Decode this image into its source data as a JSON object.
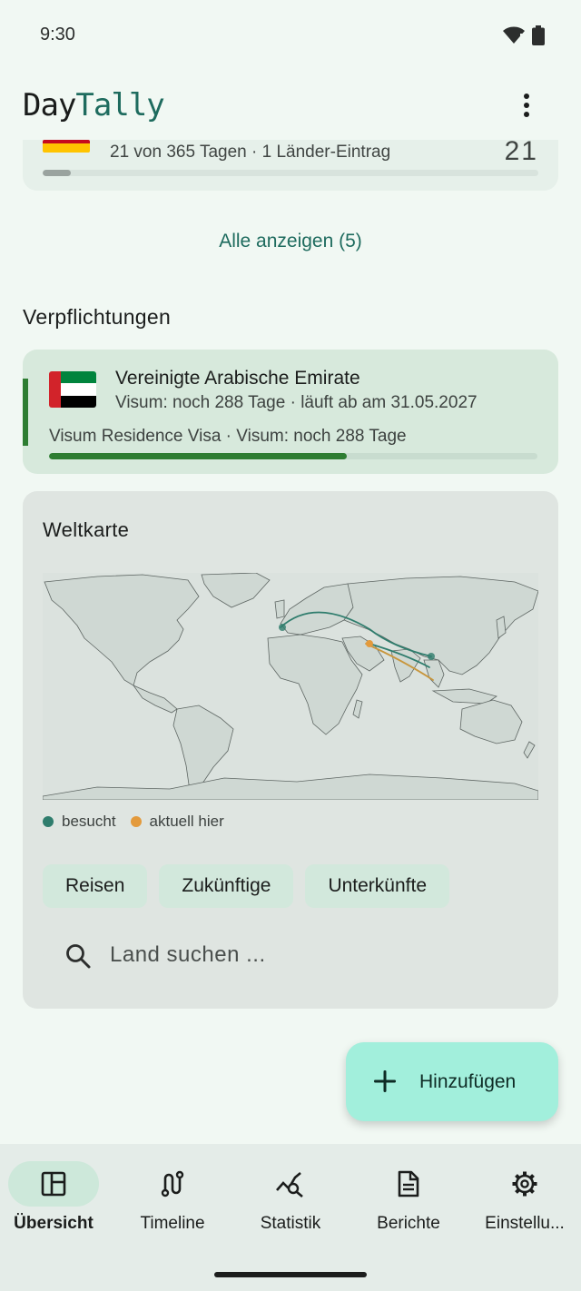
{
  "status": {
    "time": "9:30"
  },
  "app": {
    "title_part1": "Day",
    "title_part2": "Tally"
  },
  "previous_entry": {
    "summary": "21 von 365 Tagen  ·  1 Länder-Eintrag",
    "count": "21",
    "progress": 0.0575
  },
  "show_all": "Alle anzeigen (5)",
  "obligations": {
    "section_title": "Verpflichtungen",
    "items": [
      {
        "country": "Vereinigte Arabische Emirate",
        "detail": "Visum: noch 288 Tage · läuft ab am 31.05.2027",
        "visa_line": "Visum Residence Visa · Visum: noch 288 Tage",
        "progress": 0.61,
        "accent_color": "#2e7d32"
      }
    ]
  },
  "world_map": {
    "title": "Weltkarte",
    "legend": [
      {
        "label": "besucht",
        "color": "#2f7d6d"
      },
      {
        "label": "aktuell hier",
        "color": "#e39a3c"
      }
    ],
    "chips": [
      "Reisen",
      "Zukünftige",
      "Unterkünfte"
    ],
    "search_placeholder": "Land suchen ..."
  },
  "fab": {
    "label": "Hinzufügen"
  },
  "nav": {
    "items": [
      {
        "label": "Übersicht",
        "icon": "dashboard-icon",
        "active": true
      },
      {
        "label": "Timeline",
        "icon": "timeline-icon",
        "active": false
      },
      {
        "label": "Statistik",
        "icon": "statistics-icon",
        "active": false
      },
      {
        "label": "Berichte",
        "icon": "report-icon",
        "active": false
      },
      {
        "label": "Einstellu...",
        "icon": "settings-icon",
        "active": false
      }
    ]
  }
}
